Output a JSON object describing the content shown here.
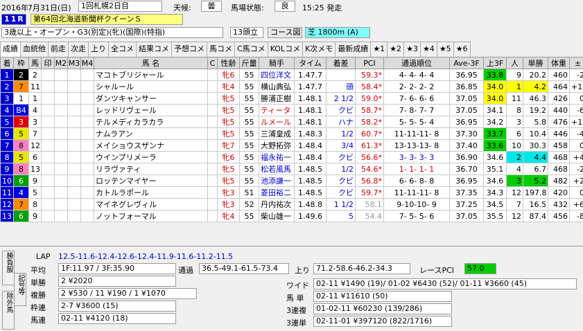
{
  "header": {
    "year": "2016年",
    "date": "7月31日(日)",
    "meeting": "1回札幌2日目",
    "weather_label": "天候:",
    "weather": "曇",
    "track_label": "馬場状態:",
    "track": "良",
    "post_time": "15:25 発走",
    "race_no": "11R",
    "race_name": "第64回北海道新聞杯クイーンＳ",
    "conditions": "3歳以上・オープン・G3(別定)(牝)(国際)(特指)",
    "runners": "13頭立",
    "course_btn": "コース図",
    "course": "芝 1800m (A)"
  },
  "tabs": [
    "成績",
    "血統他",
    "前走",
    "次走",
    "上り",
    "全コメ",
    "結果コメ",
    "予想コメ",
    "馬コメ",
    "C馬コメ",
    "KOLコメ",
    "K次メモ",
    "最新成績",
    "★1",
    "★2",
    "★3",
    "★4",
    "★5",
    "★6"
  ],
  "columns": [
    "着",
    "枠",
    "馬",
    "印",
    "M2",
    "M3",
    "M4",
    "馬 名",
    "C",
    "性齢",
    "斤量",
    "騎手",
    "タイム",
    "着差",
    "PCI",
    "通過順位",
    "Ave-3F",
    "上3F",
    "人",
    "単勝",
    "体重",
    "±"
  ],
  "rows": [
    {
      "着": "1",
      "枠": "2",
      "馬": "2",
      "名": "マコトブリジャール",
      "性齢": "牝6",
      "斤": "55",
      "騎": "四位洋文",
      "t": "1.47.7",
      "差": "",
      "pci": "59.3*",
      "通": "4- 4- 4- 4",
      "ave": "36.95",
      "up": "33.8",
      "人": "9",
      "単": "20.2",
      "体": "460",
      "pm": "-2"
    },
    {
      "着": "2",
      "枠": "7",
      "馬": "11",
      "名": "シャルール",
      "性齢": "牝4",
      "斤": "55",
      "騎": "横山典弘",
      "t": "1.47.7",
      "差": "頭",
      "pci": "58.4*",
      "通": "2- 2- 2- 2",
      "ave": "36.85",
      "up": "34.0",
      "人": "1",
      "単": "4.2",
      "体": "464",
      "pm": "+10"
    },
    {
      "着": "3",
      "枠": "1",
      "馬": "1",
      "名": "ダンツキャンサー",
      "性齢": "牝5",
      "斤": "55",
      "騎": "勝浦正樹",
      "t": "1.48.1",
      "差": "2 1/2",
      "pci": "59.0*",
      "通": "7- 6- 6- 6",
      "ave": "37.05",
      "up": "34.0",
      "人": "11",
      "単": "46.3",
      "体": "426",
      "pm": "0"
    },
    {
      "着": "4",
      "枠": "B4",
      "馬": "4",
      "名": "レッドリヴェール",
      "性齢": "牝5",
      "斤": "55",
      "騎": "ティータ",
      "t": "1.48.1",
      "差": "クビ",
      "pci": "58.7*",
      "通": "7- 8- 7- 7",
      "ave": "37.05",
      "up": "34.1",
      "人": "8",
      "単": "19.2",
      "体": "440",
      "pm": "-6"
    },
    {
      "着": "5",
      "枠": "3",
      "馬": "3",
      "名": "テルメディカラカラ",
      "性齢": "牝5",
      "斤": "55",
      "騎": "ルメール",
      "t": "1.48.1",
      "差": "ハナ",
      "pci": "58.2*",
      "通": "5- 5- 5- 4",
      "ave": "36.95",
      "up": "34.2",
      "人": "3",
      "単": "5.8",
      "体": "476",
      "pm": "+16"
    },
    {
      "着": "6",
      "枠": "5",
      "馬": "7",
      "名": "ナムラアン",
      "性齢": "牝5",
      "斤": "55",
      "騎": "三浦皇成",
      "t": "1.48.3",
      "差": "1/2",
      "pci": "60.7*",
      "通": "11-11-11- 8",
      "ave": "37.30",
      "up": "33.7",
      "人": "6",
      "単": "10.4",
      "体": "446",
      "pm": "-4"
    },
    {
      "着": "7",
      "枠": "8",
      "馬": "12",
      "名": "メイショウスザンナ",
      "性齢": "牝7",
      "斤": "55",
      "騎": "大野拓弥",
      "t": "1.48.4",
      "差": "3/4",
      "pci": "61.3*",
      "通": "13-13-13- 8",
      "ave": "37.40",
      "up": "33.6",
      "人": "10",
      "単": "30.3",
      "体": "458",
      "pm": "0"
    },
    {
      "着": "8",
      "枠": "5",
      "馬": "6",
      "名": "ウインプリメーラ",
      "性齢": "牝6",
      "斤": "55",
      "騎": "福永祐一",
      "t": "1.48.4",
      "差": "クビ",
      "pci": "56.6*",
      "通": "3- 3- 3- 3",
      "ave": "36.90",
      "up": "34.6",
      "人": "2",
      "単": "4.4",
      "体": "468",
      "pm": "+4"
    },
    {
      "着": "9",
      "枠": "8",
      "馬": "13",
      "名": "リラヴァティ",
      "性齢": "牝5",
      "斤": "55",
      "騎": "松若風馬",
      "t": "1.48.5",
      "差": "1/2",
      "pci": "54.6*",
      "通": "1- 1- 1- 1",
      "ave": "36.70",
      "up": "35.1",
      "人": "4",
      "単": "6.7",
      "体": "468",
      "pm": "-2"
    },
    {
      "着": "10",
      "枠": "6",
      "馬": "9",
      "名": "ロッテンマイヤー",
      "性齢": "牝5",
      "斤": "55",
      "騎": "池添謙一",
      "t": "1.48.5",
      "差": "クビ",
      "pci": "56.8*",
      "通": "6- 6- 8- 8",
      "ave": "36.95",
      "up": "34.6",
      "人": "3",
      "単": "5.2",
      "体": "482",
      "pm": "+2"
    },
    {
      "着": "11",
      "枠": "4",
      "馬": "5",
      "名": "カトルラポール",
      "性齢": "牝3",
      "斤": "51",
      "騎": "菱田裕二",
      "t": "1.48.5",
      "差": "クビ",
      "pci": "59.7*",
      "通": "11-11-11- 8",
      "ave": "37.35",
      "up": "34.3",
      "人": "12",
      "単": "197.8",
      "体": "420",
      "pm": "0"
    },
    {
      "着": "12",
      "枠": "7",
      "馬": "8",
      "名": "マイネグレヴィル",
      "性齢": "牝3",
      "斤": "52",
      "騎": "丹内祐次",
      "t": "1.48.8",
      "差": "1 1/2",
      "pci": "58.1",
      "通": "9-10-10- 9",
      "ave": "37.25",
      "up": "34.5",
      "人": "7",
      "単": "16.5",
      "体": "432",
      "pm": "+6"
    },
    {
      "着": "13",
      "枠": "6",
      "馬": "9",
      "名": "ノットフォーマル",
      "性齢": "牝4",
      "斤": "55",
      "騎": "柴山雄一",
      "t": "1.49.6",
      "差": "5",
      "pci": "54.4",
      "通": "7- 5- 5- 6",
      "ave": "37.05",
      "up": "35.5",
      "人": "12",
      "単": "87.4",
      "体": "456",
      "pm": "-8"
    }
  ],
  "colors": {
    "frame1": "#ffffff",
    "frame2": "#000000",
    "frame3": "#e00000",
    "frame4": "#0000e0",
    "frame5": "#e6e600",
    "frame6": "#00a000",
    "frame7": "#ff8c00",
    "frame8": "#ff80c0",
    "num_bg": "#0000cc",
    "yellow": "#ffff00",
    "green": "#00cc00",
    "cyan": "#00e6e6"
  },
  "bottom": {
    "lap_label": "LAP",
    "lap": "12.5-11.6-12.4-12.6-12.4-11.9-11.6-11.2-11.5",
    "avg_label": "平均",
    "avg": "1F:11.97 / 3F:35.90",
    "pass_label": "通過",
    "pass": "36.5-49.1-61.5-73.4",
    "up_label": "上り",
    "up": "71.2-58.6-46.2-34.3",
    "pci_label": "レースPCI",
    "pci": "57.0",
    "win_label": "単勝",
    "win": "2 ¥2020",
    "place_label": "複勝",
    "place": "2 ¥530 / 11 ¥190 / 1 ¥1070",
    "bracket_label": "枠連",
    "bracket": "2-7 ¥3600 (15)",
    "quinella_label": "馬連",
    "quinella": "02-11 ¥4120 (18)",
    "wide_label": "ワイド",
    "wide": "02-11 ¥1490 (19)/ 01-02 ¥6430 (52)/ 01-11 ¥3660 (45)",
    "exacta_label": "馬 単",
    "exacta": "02-11 ¥11610 (50)",
    "trio_label": "3連複",
    "trio": "01-02-11 ¥60230 (139/286)",
    "trifecta_label": "3連単",
    "trifecta": "02-11-01 ¥397120 (822/1716)",
    "side1": "勝負服",
    "side2": "記号等",
    "side3": "除外馬"
  }
}
